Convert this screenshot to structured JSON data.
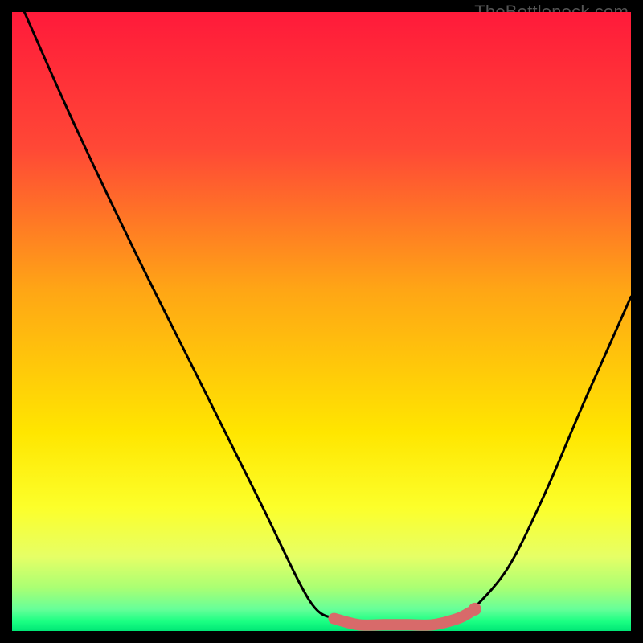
{
  "attribution": "TheBottleneck.com",
  "chart_data": {
    "type": "line",
    "title": "",
    "xlabel": "",
    "ylabel": "",
    "xlim": [
      0,
      100
    ],
    "ylim": [
      0,
      100
    ],
    "gradient_stops": [
      {
        "pos": 0.0,
        "color": "#ff1a3a"
      },
      {
        "pos": 0.22,
        "color": "#ff4836"
      },
      {
        "pos": 0.45,
        "color": "#ffa615"
      },
      {
        "pos": 0.68,
        "color": "#ffe600"
      },
      {
        "pos": 0.8,
        "color": "#fcff2a"
      },
      {
        "pos": 0.88,
        "color": "#e6ff66"
      },
      {
        "pos": 0.93,
        "color": "#aaff73"
      },
      {
        "pos": 0.965,
        "color": "#66ff99"
      },
      {
        "pos": 0.985,
        "color": "#1aff82"
      },
      {
        "pos": 1.0,
        "color": "#00e676"
      }
    ],
    "series": [
      {
        "name": "left-curve",
        "x": [
          2,
          10,
          20,
          30,
          40,
          48,
          52
        ],
        "y": [
          100,
          82,
          61,
          41,
          21,
          5,
          2
        ]
      },
      {
        "name": "valley-floor",
        "x": [
          52,
          56,
          60,
          64,
          68,
          72,
          74
        ],
        "y": [
          2,
          1,
          1,
          1,
          1,
          2,
          3
        ]
      },
      {
        "name": "right-curve",
        "x": [
          74,
          80,
          86,
          92,
          96,
          100
        ],
        "y": [
          3,
          10,
          22,
          36,
          45,
          54
        ]
      }
    ],
    "highlight_segment": {
      "name": "valley-highlight",
      "color": "#d86a6a",
      "x": [
        52,
        56,
        60,
        64,
        68,
        72,
        74
      ],
      "y": [
        2,
        1,
        1,
        1,
        1,
        2,
        3
      ]
    }
  }
}
